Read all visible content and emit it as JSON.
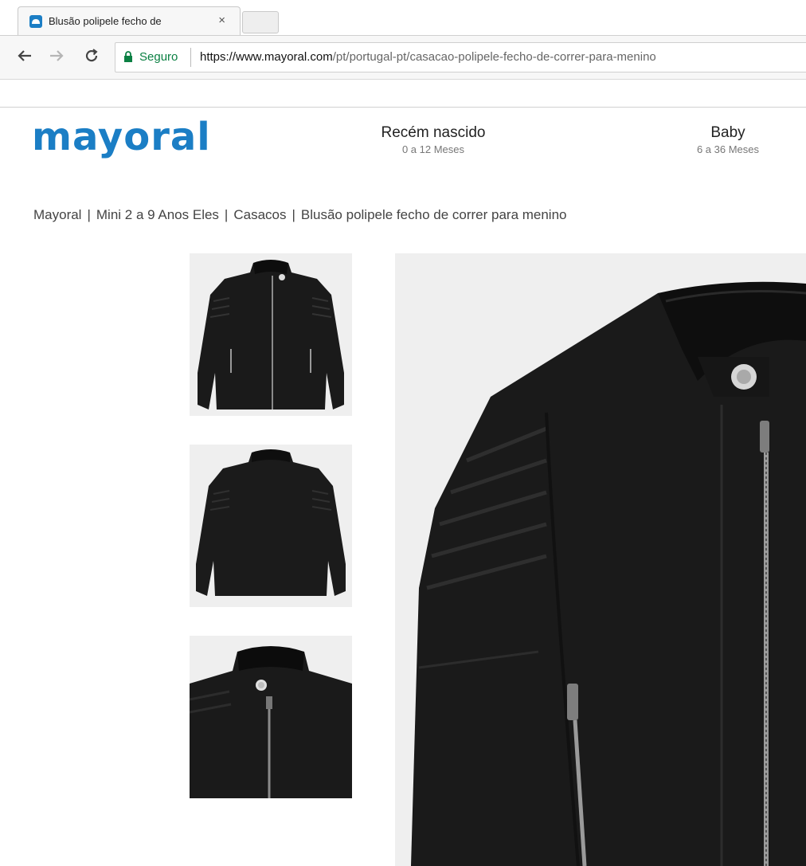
{
  "browser": {
    "tab_title": "Blusão polipele fecho de",
    "tab_close": "×",
    "secure_label": "Seguro",
    "url_host": "https://www.mayoral.com",
    "url_path": "/pt/portugal-pt/casacao-polipele-fecho-de-correr-para-menino"
  },
  "header": {
    "logo": "mayoral",
    "nav": [
      {
        "title": "Recém nascido",
        "subtitle": "0 a 12 Meses"
      },
      {
        "title": "Baby",
        "subtitle": "6 a 36 Meses"
      }
    ]
  },
  "breadcrumb": [
    "Mayoral",
    "Mini 2 a 9 Anos Eles",
    "Casacos",
    "Blusão polipele fecho de correr para menino"
  ],
  "colors": {
    "brand": "#1b7ec5",
    "secure": "#0b8043",
    "jacket": "#1a1a1a"
  },
  "icons": {
    "back": "arrow-left",
    "forward": "arrow-right",
    "reload": "reload",
    "lock": "lock",
    "favicon": "mayoral-cloud"
  }
}
